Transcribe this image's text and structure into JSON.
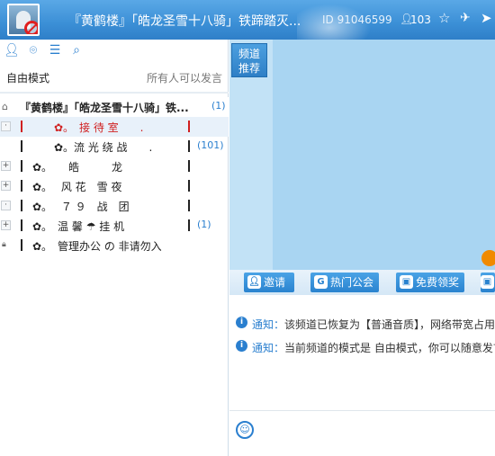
{
  "header": {
    "title": "『黄鹤楼』「皓龙圣雪十八骑」铁蹄踏灭...",
    "id_text": "ID 91046599",
    "online_count": "103",
    "icons": [
      "avatar",
      "user-icon",
      "star-icon",
      "plane-icon",
      "arrow-icon"
    ]
  },
  "left": {
    "toolbar_icons": [
      "user-icon",
      "location-icon",
      "list-icon",
      "search-icon"
    ],
    "mode_label": "自由模式",
    "permission_label": "所有人可以发言",
    "tree": {
      "root": {
        "name": "『黄鹤楼』「皓龙圣雪十八骑」铁...",
        "count": "(1)"
      },
      "channels": [
        {
          "name": "✿。　接 待 室　　.",
          "count": "",
          "selected": true,
          "expander": "·"
        },
        {
          "name": "✿。流 光 绕 战　　.",
          "count": "(101)",
          "selected": false,
          "expander": ""
        },
        {
          "name": "✿。　　皓　　　龙",
          "count": "",
          "selected": false,
          "expander": "+"
        },
        {
          "name": "✿。　 风 花　雪 夜",
          "count": "",
          "selected": false,
          "expander": "+"
        },
        {
          "name": "✿。　 ７ ９　战　团",
          "count": "",
          "selected": false,
          "expander": "·"
        },
        {
          "name": "✿。　温 馨 ☂ 挂 机",
          "count": "(1)",
          "selected": false,
          "expander": "+"
        },
        {
          "name": "✿。　管理办公 の 非请勿入",
          "count": "",
          "selected": false,
          "expander": "lock"
        }
      ]
    }
  },
  "right": {
    "recommend_button": "频道\n推荐",
    "tabs": [
      {
        "label": "邀请",
        "icon": "invite-icon"
      },
      {
        "label": "热门公会",
        "icon": "guild-icon"
      },
      {
        "label": "免费领奖",
        "icon": "gift-icon"
      },
      {
        "label": "",
        "icon": "more-icon"
      }
    ],
    "notices": [
      {
        "label": "通知：",
        "text": "该频道已恢复为【普通音质】，网络带宽占用"
      },
      {
        "label": "通知：",
        "text": "当前频道的模式是 自由模式，你可以随意发言"
      }
    ]
  },
  "colors": {
    "header_blue": "#3b8fd6",
    "accent_blue": "#2a7fcf",
    "selected_red": "#d02020",
    "video_bg": "#a9d5f2",
    "orange": "#f08a00"
  }
}
